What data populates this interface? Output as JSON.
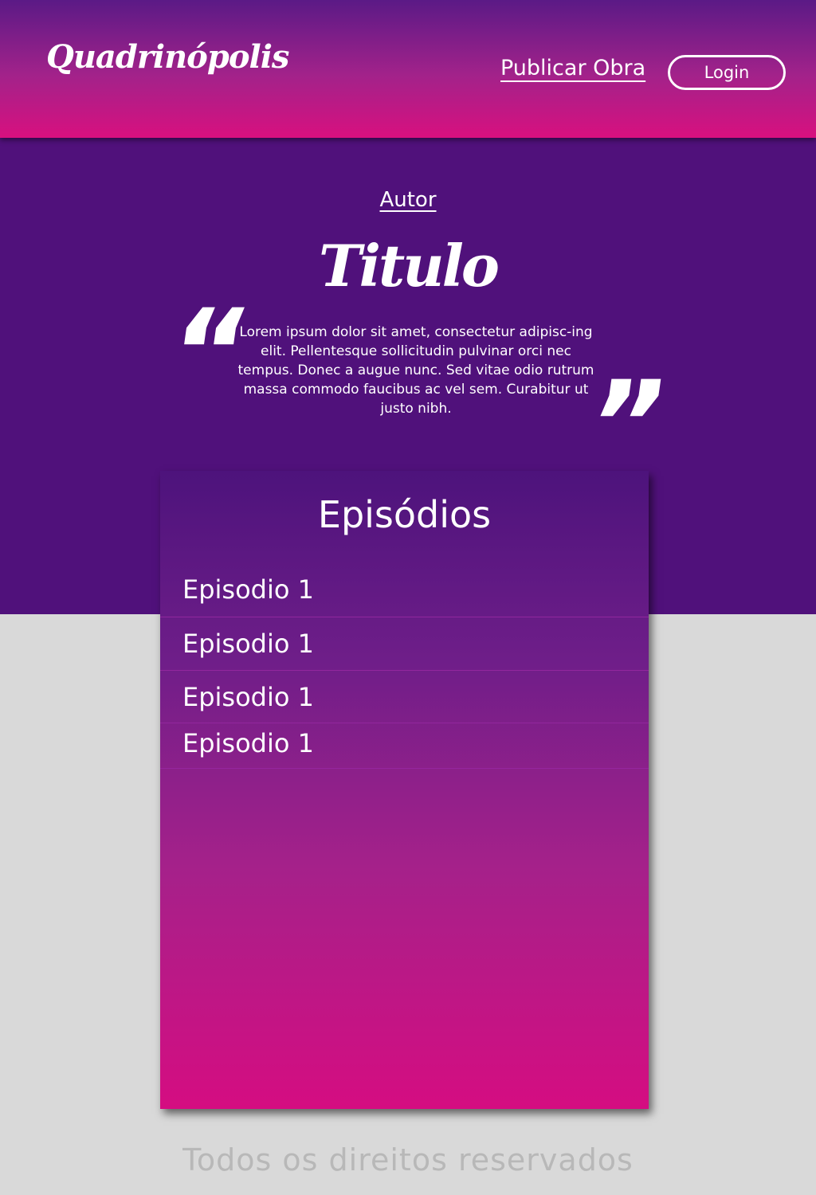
{
  "header": {
    "logo_text": "Quadrinópolis",
    "publish_link": "Publicar Obra",
    "login_button": "Login"
  },
  "hero": {
    "author_link": "Autor",
    "title": "Titulo",
    "open_quote": "“",
    "close_quote": "”",
    "description": "Lorem ipsum dolor sit amet, consectetur adipisc-ing elit. Pellentesque sollicitudin pulvinar orci nec tempus. Donec a augue nunc. Sed vitae odio rutrum massa commodo faucibus ac vel sem. Curabitur ut justo nibh."
  },
  "episodes": {
    "heading": "Episódios",
    "items": [
      {
        "label": "Episodio 1"
      },
      {
        "label": "Episodio 1"
      },
      {
        "label": "Episodio 1"
      },
      {
        "label": "Episodio 1"
      }
    ]
  },
  "footer": {
    "text": "Todos os direitos reservados"
  },
  "colors": {
    "header_top": "#5b1a86",
    "header_bottom": "#d8107f",
    "hero_background": "#50117b",
    "panel_top": "#4d137c",
    "panel_bottom": "#d50d81",
    "page_background": "#d9d9d9",
    "footer_text": "#b8b8b8"
  }
}
